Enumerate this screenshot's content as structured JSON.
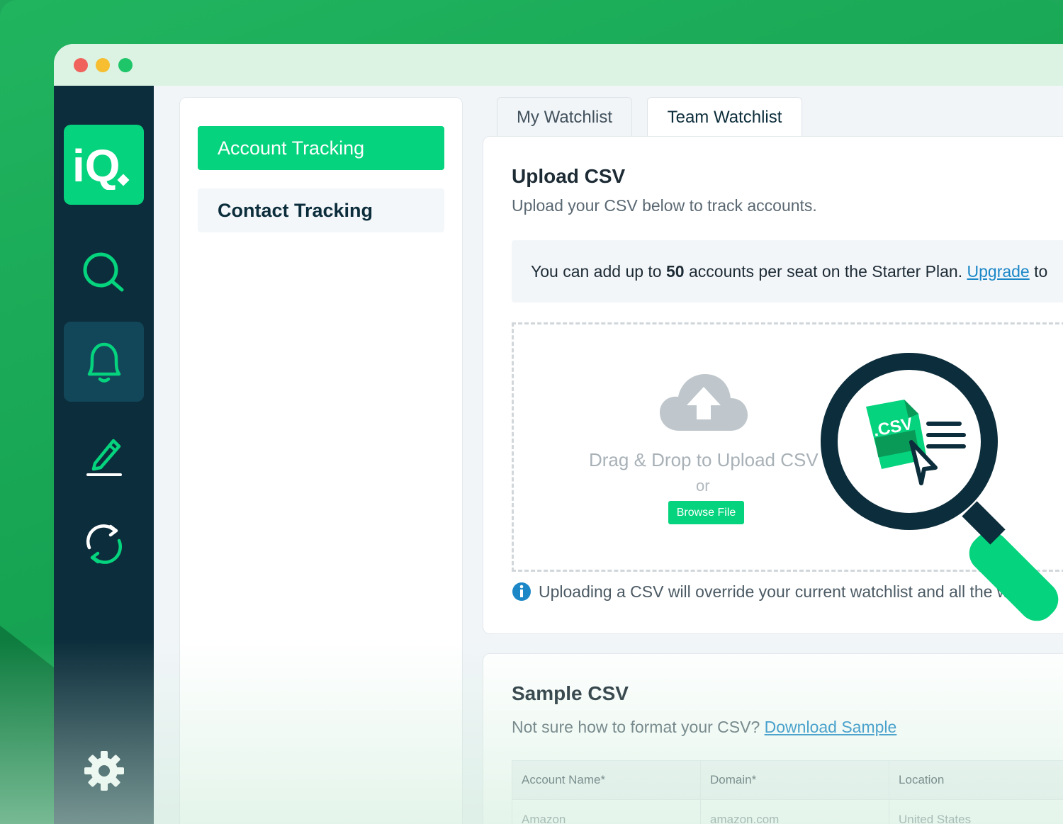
{
  "colors": {
    "brand_green": "#05d37d",
    "sidebar_navy": "#0c2d3b",
    "link_blue": "#1b87c7",
    "background_green": "#1da85a"
  },
  "sidebar": {
    "logo_text": "iQ",
    "nav": [
      {
        "icon": "search-icon"
      },
      {
        "icon": "bell-icon",
        "active": true
      },
      {
        "icon": "pencil-icon"
      },
      {
        "icon": "refresh-icon"
      },
      {
        "icon": "gear-icon"
      }
    ]
  },
  "left_menu": {
    "items": [
      {
        "label": "Account Tracking",
        "active": true
      },
      {
        "label": "Contact Tracking",
        "active": false
      }
    ]
  },
  "tabs": [
    {
      "label": "My Watchlist",
      "active": false
    },
    {
      "label": "Team Watchlist",
      "active": true
    }
  ],
  "upload": {
    "title": "Upload CSV",
    "subtitle": "Upload your CSV below to track accounts.",
    "notice_prefix": "You can add up to ",
    "notice_limit": "50",
    "notice_suffix": " accounts per seat on the Starter Plan. ",
    "notice_link": "Upgrade",
    "notice_tail": " to",
    "dropzone_title": "Drag & Drop to Upload CSV",
    "dropzone_or": "or",
    "browse_label": "Browse File",
    "illustration_label": ".CSV",
    "info_text": "Uploading a CSV will override your current watchlist and all the wa"
  },
  "sample": {
    "title": "Sample CSV",
    "prompt": "Not sure how to format your CSV? ",
    "link": "Download Sample",
    "columns": [
      "Account Name*",
      "Domain*",
      "Location"
    ],
    "rows": [
      [
        "Amazon",
        "amazon.com",
        "United States"
      ]
    ]
  }
}
